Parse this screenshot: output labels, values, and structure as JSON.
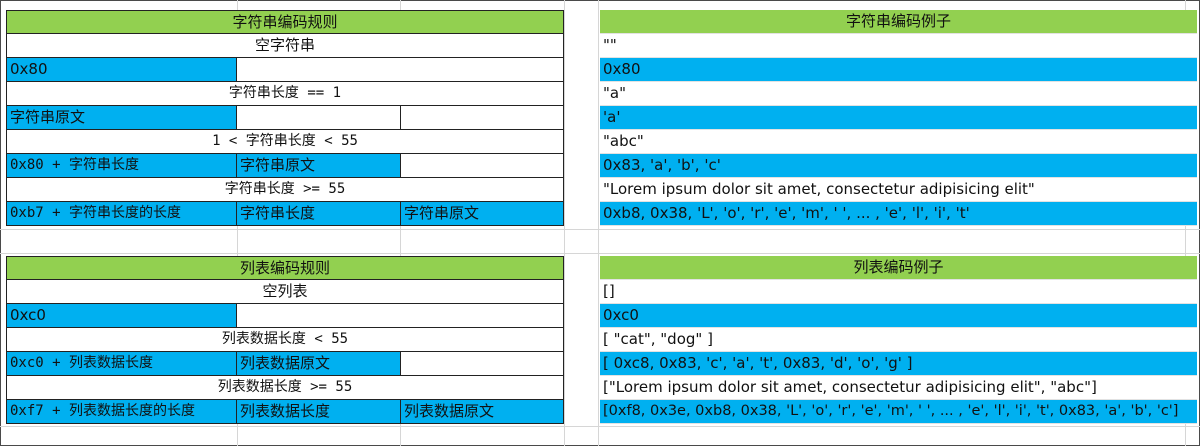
{
  "string_rules": {
    "header": "字符串编码规则",
    "empty_string": "空字符串",
    "empty_prefix": "0x80",
    "len_eq_1": "字符串长度 == 1",
    "raw": "字符串原文",
    "len_1_to_55": "1 < 字符串长度 < 55",
    "short_prefix": "0x80 + 字符串长度",
    "short_raw": "字符串原文",
    "len_ge_55": "字符串长度 >= 55",
    "long_prefix": "0xb7 + 字符串长度的长度",
    "long_len": "字符串长度",
    "long_raw": "字符串原文"
  },
  "string_examples": {
    "header": "字符串编码例子",
    "items": [
      "\"\"",
      "0x80",
      "\"a\"",
      "'a'",
      "\"abc\"",
      "0x83, 'a', 'b', 'c'",
      "\"Lorem ipsum dolor sit amet, consectetur adipisicing elit\"",
      "0xb8, 0x38, 'L', 'o', 'r', 'e', 'm', ' ', ... , 'e', 'l', 'i', 't'"
    ]
  },
  "list_rules": {
    "header": "列表编码规则",
    "empty_list": "空列表",
    "empty_prefix": "0xc0",
    "len_lt_55": "列表数据长度 < 55",
    "short_prefix": "0xc0 + 列表数据长度",
    "short_raw": "列表数据原文",
    "len_ge_55": "列表数据长度 >= 55",
    "long_prefix": "0xf7 + 列表数据长度的长度",
    "long_len": "列表数据长度",
    "long_raw": "列表数据原文"
  },
  "list_examples": {
    "header": "列表编码例子",
    "items": [
      "[]",
      "0xc0",
      "[ \"cat\", \"dog\" ]",
      "[ 0xc8, 0x83, 'c', 'a', 't', 0x83, 'd', 'o', 'g' ]",
      "[\"Lorem ipsum dolor sit amet, consectetur adipisicing elit\", \"abc\"]",
      "[0xf8, 0x3e, 0xb8, 0x38, 'L', 'o', 'r', 'e', 'm', ' ', ... , 'e', 'l', 'i', 't', 0x83, 'a', 'b', 'c']"
    ]
  },
  "colors": {
    "header": "#92d050",
    "highlight": "#00b0f0"
  }
}
